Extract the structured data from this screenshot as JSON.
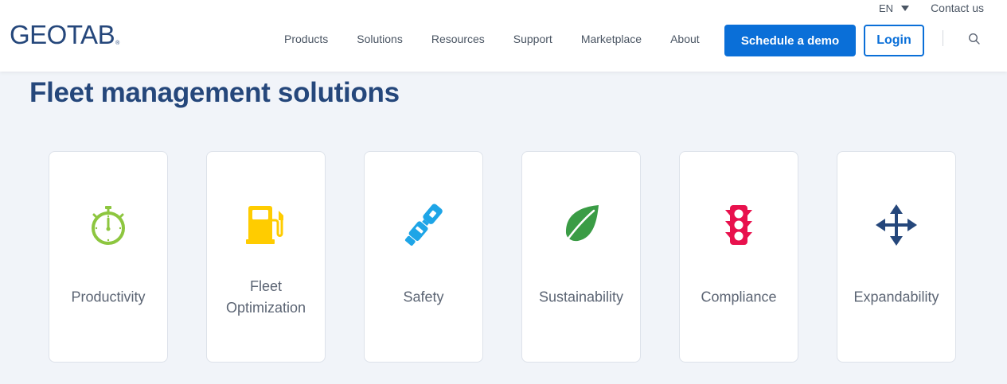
{
  "header": {
    "language": "EN",
    "contact_label": "Contact us",
    "logo_text": "GEOTAB",
    "logo_mark": "®",
    "nav": [
      "Products",
      "Solutions",
      "Resources",
      "Support",
      "Marketplace",
      "About"
    ],
    "demo_button": "Schedule a demo",
    "login_button": "Login"
  },
  "main": {
    "title": "Fleet management solutions",
    "cards": [
      {
        "label": "Productivity",
        "icon": "stopwatch-icon",
        "color": "#8dc63f"
      },
      {
        "label": "Fleet Optimization",
        "icon": "fuel-pump-icon",
        "color": "#ffcc00"
      },
      {
        "label": "Safety",
        "icon": "seatbelt-icon",
        "color": "#1ea5e7"
      },
      {
        "label": "Sustainability",
        "icon": "leaf-icon",
        "color": "#3a9c45"
      },
      {
        "label": "Compliance",
        "icon": "traffic-light-icon",
        "color": "#e8114d"
      },
      {
        "label": "Expandability",
        "icon": "expand-arrows-icon",
        "color": "#25477b"
      }
    ]
  },
  "colors": {
    "brand": "#25477b",
    "accent": "#0a6fd8",
    "background": "#f1f4f9"
  }
}
